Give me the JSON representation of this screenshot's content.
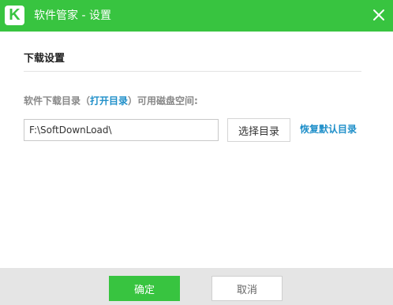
{
  "window": {
    "logo_letter": "K",
    "logo_icon": "software-manager-logo-icon",
    "title": "软件管家 - 设置",
    "close_icon": "close-icon"
  },
  "download_settings": {
    "section_title": "下载设置",
    "dir_label_prefix": "软件下载目录（",
    "open_dir_link": "打开目录",
    "dir_label_suffix": "）可用磁盘空间:",
    "path_value": "F:\\SoftDownLoad\\",
    "choose_dir_button": "选择目录",
    "restore_default_link": "恢复默认目录"
  },
  "footer": {
    "confirm_button": "确定",
    "cancel_button": "取消"
  },
  "colors": {
    "brand_green": "#38c440",
    "link_blue": "#1f8fc9",
    "footer_gray": "#e5e5e5"
  }
}
